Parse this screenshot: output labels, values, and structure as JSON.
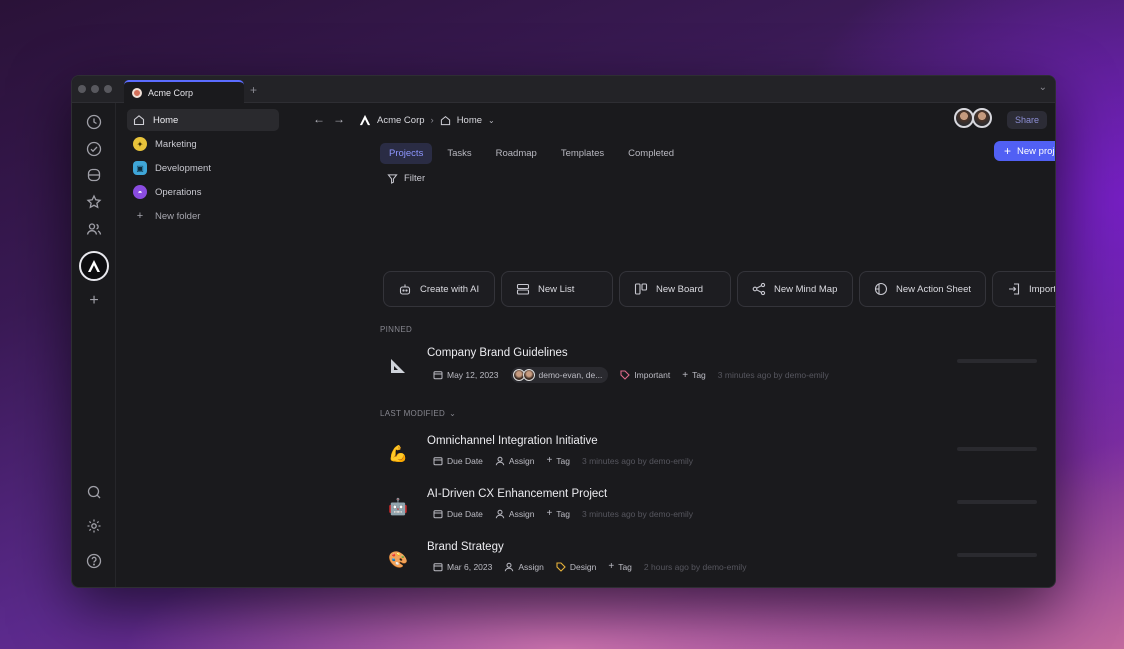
{
  "window": {
    "tab_title": "Acme Corp"
  },
  "sidebar": {
    "items": [
      {
        "label": "Home"
      },
      {
        "label": "Marketing"
      },
      {
        "label": "Development"
      },
      {
        "label": "Operations"
      },
      {
        "label": "New folder"
      }
    ]
  },
  "header": {
    "breadcrumb_workspace": "Acme Corp",
    "breadcrumb_page": "Home",
    "share_label": "Share"
  },
  "tabs": [
    {
      "label": "Projects"
    },
    {
      "label": "Tasks"
    },
    {
      "label": "Roadmap"
    },
    {
      "label": "Templates"
    },
    {
      "label": "Completed"
    }
  ],
  "new_project_label": "New project",
  "filter_label": "Filter",
  "actions": [
    {
      "label": "Create with AI",
      "icon": "robot-icon"
    },
    {
      "label": "New List",
      "icon": "list-icon"
    },
    {
      "label": "New Board",
      "icon": "board-icon"
    },
    {
      "label": "New Mind Map",
      "icon": "mindmap-icon"
    },
    {
      "label": "New Action Sheet",
      "icon": "sheet-icon"
    },
    {
      "label": "Import",
      "icon": "import-icon"
    }
  ],
  "sections": {
    "pinned": "PINNED",
    "last_modified": "LAST MODIFIED"
  },
  "pinned_project": {
    "title": "Company Brand Guidelines",
    "icon": "triangle-ruler-icon",
    "date": "May 12, 2023",
    "assignees": "demo-evan, de...",
    "tag": "Important",
    "add_tag": "Tag",
    "modified": "3 minutes ago by demo-emily"
  },
  "projects": [
    {
      "title": "Omnichannel Integration Initiative",
      "emoji": "💪",
      "date": "Due Date",
      "assign": "Assign",
      "add_tag": "Tag",
      "modified": "3 minutes ago by demo-emily"
    },
    {
      "title": "AI-Driven CX Enhancement Project",
      "emoji": "🤖",
      "date": "Due Date",
      "assign": "Assign",
      "add_tag": "Tag",
      "modified": "3 minutes ago by demo-emily"
    },
    {
      "title": "Brand Strategy",
      "emoji": "🎨",
      "date": "Mar 6, 2023",
      "assign": "Assign",
      "tag": "Design",
      "add_tag": "Tag",
      "modified": "2 hours ago by demo-emily"
    }
  ],
  "colors": {
    "accent": "#5160f4",
    "tag_important": "#e06a8a",
    "tag_design": "#e8b33a"
  }
}
